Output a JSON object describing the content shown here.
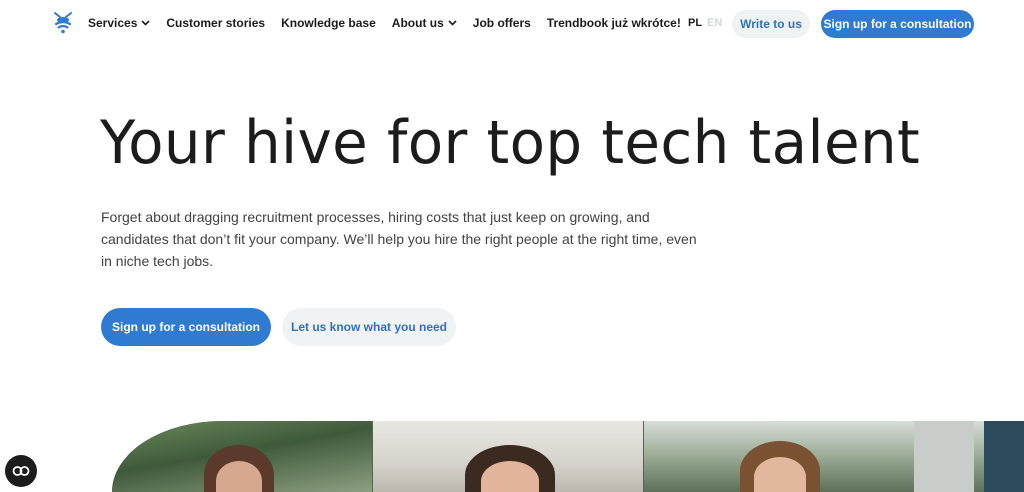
{
  "header": {
    "logo_icon": "bee-logo-icon",
    "menu": [
      {
        "label": "Services",
        "has_dropdown": true
      },
      {
        "label": "Customer stories",
        "has_dropdown": false
      },
      {
        "label": "Knowledge base",
        "has_dropdown": false
      },
      {
        "label": "About us",
        "has_dropdown": true
      },
      {
        "label": "Job offers",
        "has_dropdown": false
      },
      {
        "label": "Trendbook już wkrótce!",
        "has_dropdown": false
      }
    ],
    "languages": {
      "active": "PL",
      "inactive": "EN"
    },
    "write_button": "Write to us",
    "signup_button": "Sign up for a consultation"
  },
  "hero": {
    "title": "Your hive for top tech talent",
    "description": "Forget about dragging recruitment processes, hiring costs that just keep on growing, and candidates that don’t fit your company. We’ll help you hire the right people at the right time, even in niche tech jobs.",
    "primary_button": "Sign up for a consultation",
    "secondary_button": "Let us know what you need"
  },
  "cookie_widget": {
    "icon": "cookie-settings-icon"
  },
  "colors": {
    "accent": "#2f7ad2",
    "accent_text": "#2f72c4",
    "light_button": "#f1f2f4",
    "text": "#1c1c1c",
    "inactive_language": "#d3d6db"
  }
}
